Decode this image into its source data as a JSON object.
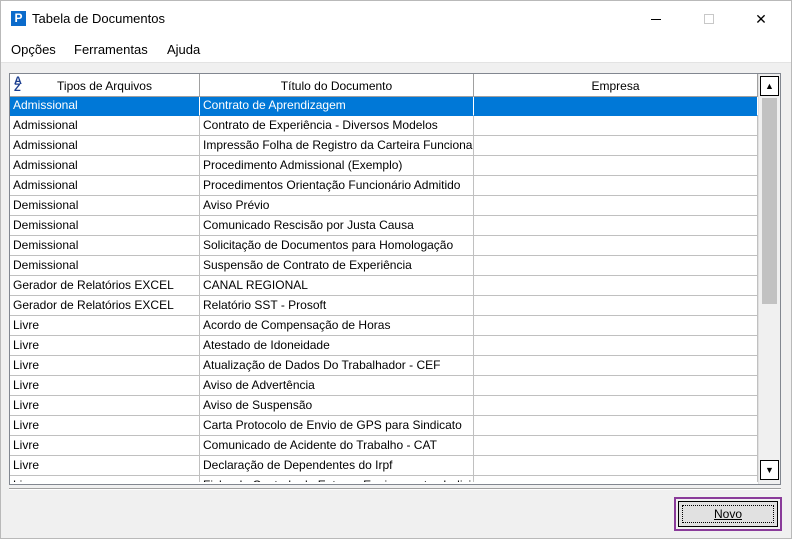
{
  "window": {
    "title": "Tabela de Documentos",
    "app_icon_letter": "P",
    "controls": {
      "minimize": "—",
      "maximize": "☐",
      "close": "✕"
    }
  },
  "menu": [
    "Opções",
    "Ferramentas",
    "Ajuda"
  ],
  "grid": {
    "columns": [
      "Tipos de Arquivos",
      "Título do Documento",
      "Empresa"
    ],
    "sort_icon": "A↓Z",
    "selected_row": 0,
    "rows": [
      [
        "Admissional",
        "Contrato de Aprendizagem",
        ""
      ],
      [
        "Admissional",
        "Contrato de Experiência - Diversos Modelos",
        ""
      ],
      [
        "Admissional",
        "Impressão Folha de Registro da Carteira Funcional",
        ""
      ],
      [
        "Admissional",
        "Procedimento Admissional (Exemplo)",
        ""
      ],
      [
        "Admissional",
        "Procedimentos Orientação Funcionário Admitido",
        ""
      ],
      [
        "Demissional",
        "Aviso Prévio",
        ""
      ],
      [
        "Demissional",
        "Comunicado Rescisão por Justa Causa",
        ""
      ],
      [
        "Demissional",
        "Solicitação de Documentos para Homologação",
        ""
      ],
      [
        "Demissional",
        "Suspensão de Contrato de Experiência",
        ""
      ],
      [
        "Gerador de Relatórios EXCEL",
        "CANAL REGIONAL",
        ""
      ],
      [
        "Gerador de Relatórios EXCEL",
        "Relatório SST - Prosoft",
        ""
      ],
      [
        "Livre",
        "Acordo de Compensação de Horas",
        ""
      ],
      [
        "Livre",
        "Atestado de Idoneidade",
        ""
      ],
      [
        "Livre",
        "Atualização de Dados Do Trabalhador - CEF",
        ""
      ],
      [
        "Livre",
        "Aviso de Advertência",
        ""
      ],
      [
        "Livre",
        "Aviso de Suspensão",
        ""
      ],
      [
        "Livre",
        "Carta Protocolo de Envio de GPS para Sindicato",
        ""
      ],
      [
        "Livre",
        "Comunicado de Acidente do Trabalho - CAT",
        ""
      ],
      [
        "Livre",
        "Declaração de Dependentes do Irpf",
        ""
      ],
      [
        "Livre",
        "Ficha de Controle de Entrega Equipamentos Individuais",
        ""
      ]
    ]
  },
  "buttons": {
    "novo": "Novo"
  },
  "colors": {
    "selection": "#0078d7",
    "highlight_border": "#8a3b9a",
    "app_icon": "#0b6bcb"
  }
}
